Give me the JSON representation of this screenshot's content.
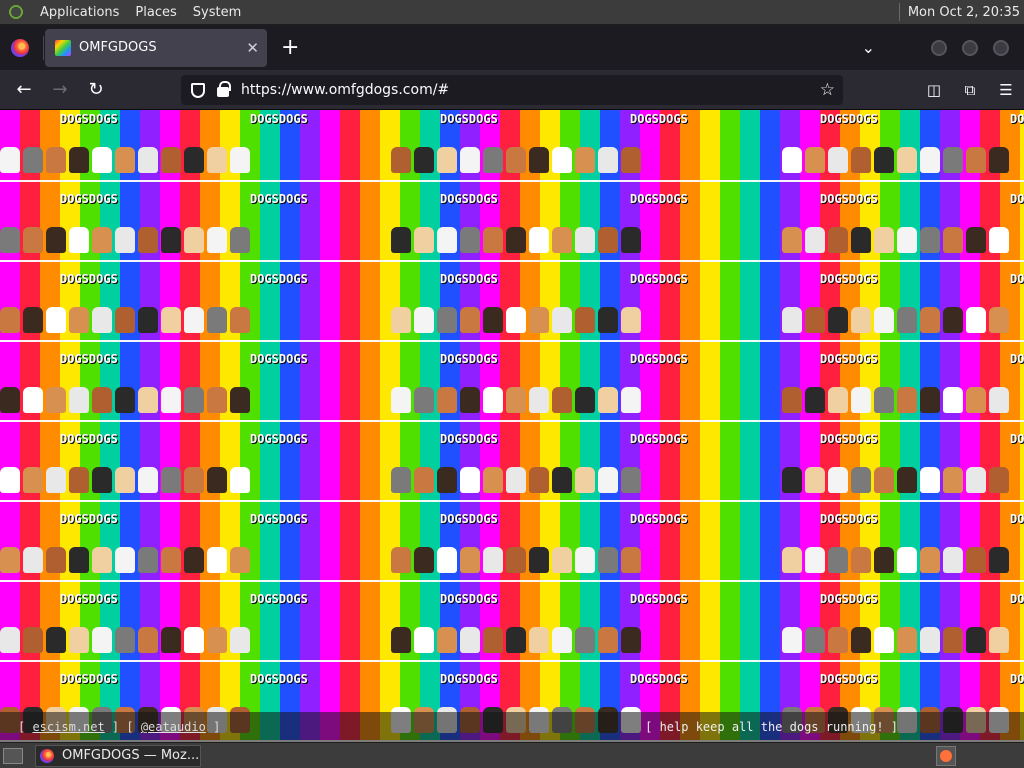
{
  "top_panel": {
    "menus": [
      "Applications",
      "Places",
      "System"
    ],
    "clock": "Mon Oct  2, 20:35"
  },
  "browser": {
    "tab_title": "OMFGDOGS",
    "url": "https://www.omfgdogs.com/#"
  },
  "page": {
    "background_word": "DOGS",
    "footer_links": [
      "escism.net",
      "@eataudio"
    ],
    "footer_message": "[ help keep all the dogs running! ]"
  },
  "taskbar": {
    "window_label": "OMFGDOGS — Moz..."
  }
}
